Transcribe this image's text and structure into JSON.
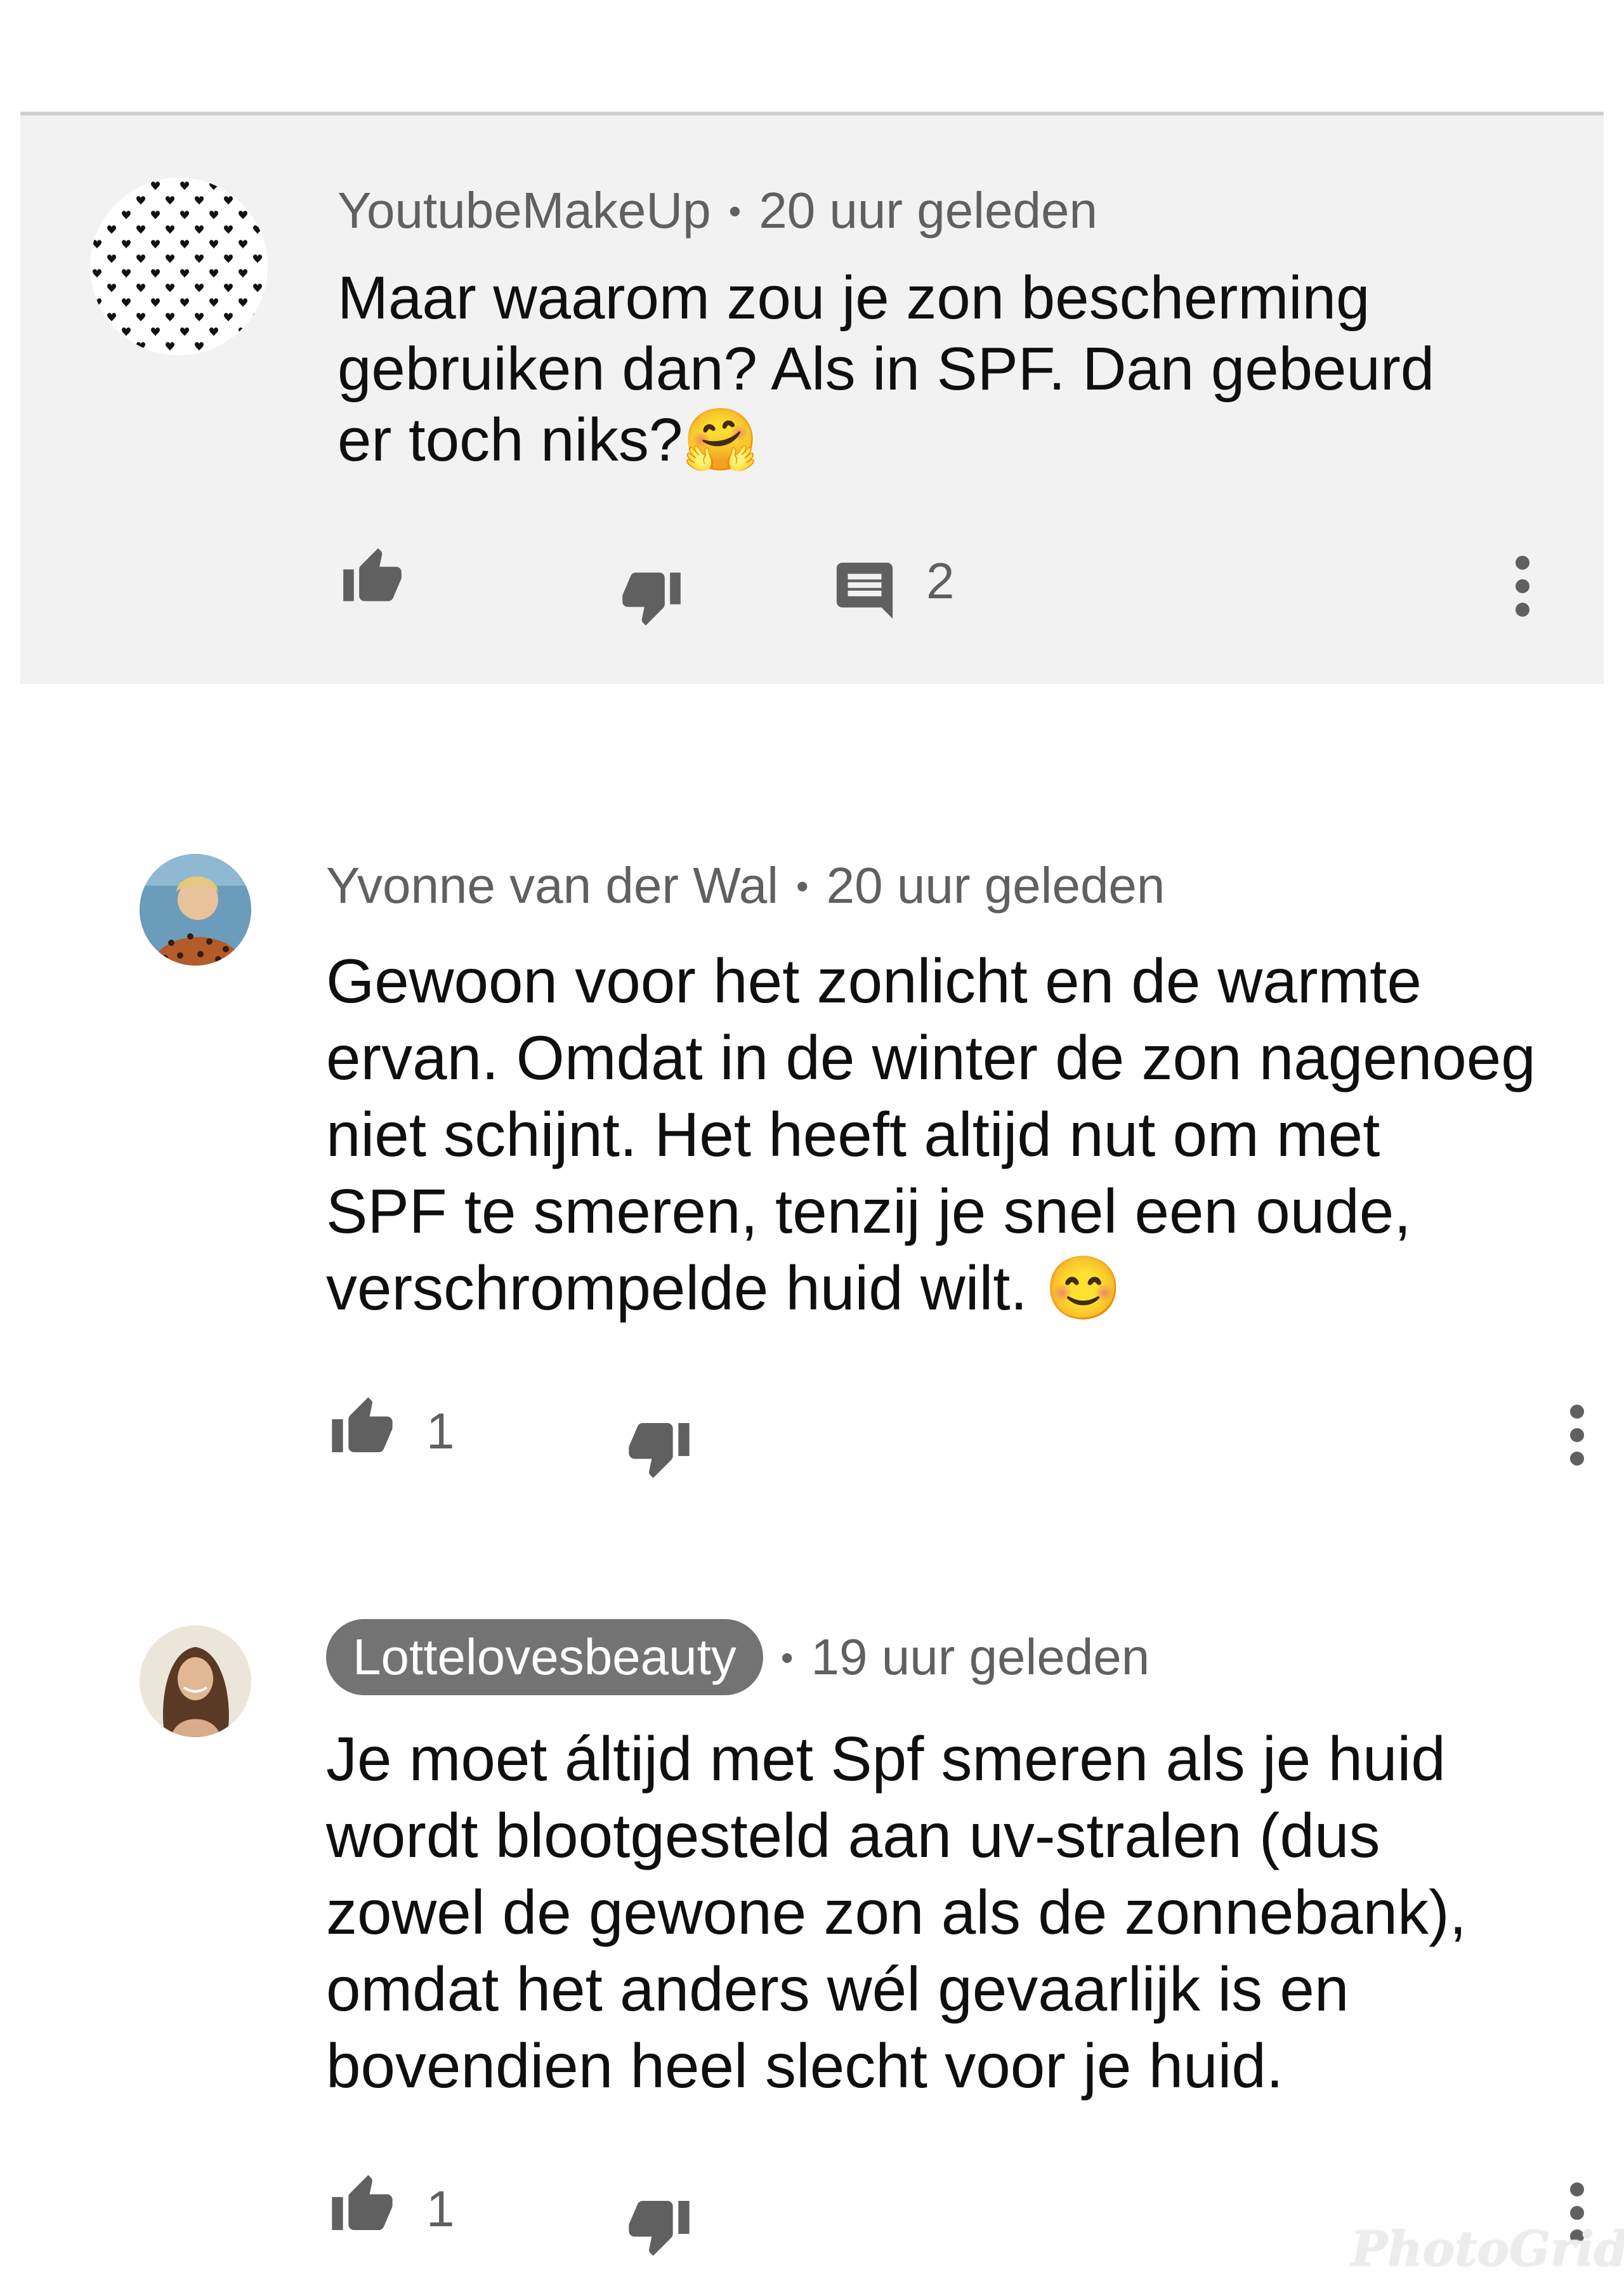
{
  "comments": [
    {
      "author": "YoutubeMakeUp",
      "time": "20 uur geleden",
      "text": "Maar waarom zou je zon bescherming\ngebruiken dan? Als in SPF. Dan gebeurd\ner toch niks?🤗",
      "likes": "",
      "replies": "2",
      "highlighted": true
    },
    {
      "author": "Yvonne van der Wal",
      "time": "20 uur geleden",
      "text": "Gewoon voor het zonlicht en de warmte\nervan. Omdat in de winter de zon nagenoeg\nniet schijnt. Het heeft altijd nut om met\nSPF te smeren, tenzij je snel een oude,\nverschrompelde huid wilt. 😊",
      "likes": "1"
    },
    {
      "author": "Lottelovesbeauty",
      "time": "19 uur geleden",
      "text": "Je moet áltijd met Spf smeren als je huid\nwordt blootgesteld aan uv-stralen (dus\nzowel de gewone zon als de zonnebank),\nomdat het anders wél gevaarlijk is en\nbovendien heel slecht voor je huid.",
      "likes": "1",
      "author_is_creator": true
    }
  ],
  "separator": "•",
  "watermark": "PhotoGrid",
  "icons": {
    "like": "thumb-up-icon",
    "dislike": "thumb-down-icon",
    "reply": "comment-icon",
    "menu": "more-vert-icon"
  },
  "colors": {
    "highlight_bg": "#f2f2f2",
    "meta_text": "#606060",
    "creator_chip": "#737373"
  }
}
